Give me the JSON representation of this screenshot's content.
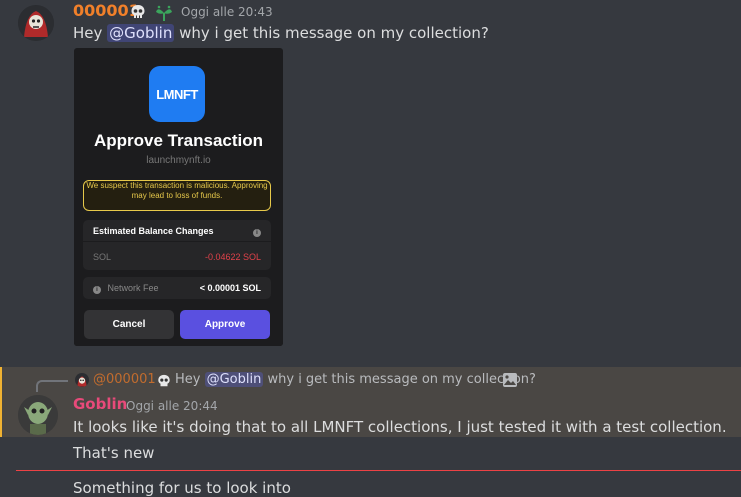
{
  "message1": {
    "username": "000001",
    "timestamp": "Oggi alle 20:43",
    "text_prefix": "Hey ",
    "mention": "@Goblin",
    "text_suffix": " why i get this message on my collection?"
  },
  "embed": {
    "logo_text": "LMNFT",
    "title": "Approve Transaction",
    "domain": "launchmynft.io",
    "warning": "We suspect this transaction is malicious. Approving may lead to loss of funds.",
    "balance_header": "Estimated Balance Changes",
    "token": "SOL",
    "token_change": "-0.04622 SOL",
    "fee_label": "Network Fee",
    "fee_value": "< 0.00001 SOL",
    "cancel_label": "Cancel",
    "approve_label": "Approve",
    "colors": {
      "warning": "#e6c84a",
      "approve": "#5a50e0",
      "negative": "#e0424a",
      "logo": "#1f7cf2"
    }
  },
  "message2": {
    "reply": {
      "username": "@000001",
      "text_prefix": "Hey ",
      "mention": "@Goblin",
      "text_suffix": " why i get this message on my collection?"
    },
    "username": "Goblin",
    "timestamp": "Oggi alle 20:44",
    "text": "It looks like it's doing that to all LMNFT collections, I just tested it with a test collection."
  },
  "message3": {
    "text": "That's new"
  },
  "message4": {
    "text": "Something for us to look into"
  },
  "colors": {
    "background": "#36393f",
    "highlight": "#4a4744",
    "highlight_bar": "#f0b232",
    "new_divider": "#ed4245"
  }
}
